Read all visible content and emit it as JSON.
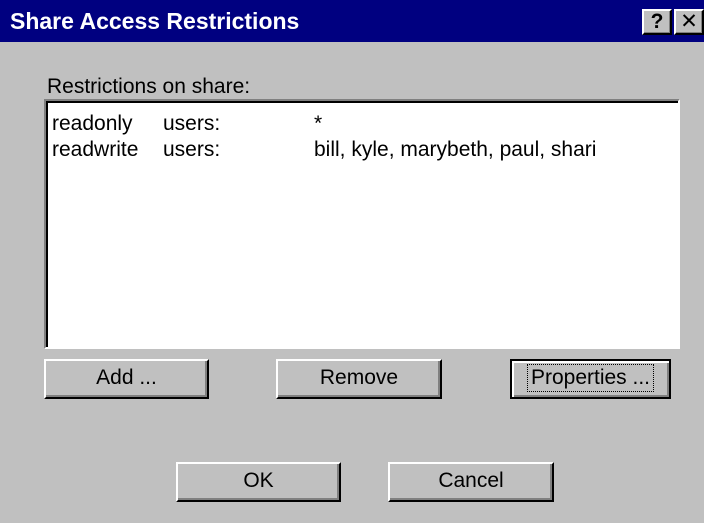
{
  "window": {
    "title": "Share Access Restrictions",
    "help_glyph": "?",
    "close_glyph": "✕"
  },
  "restrictions": {
    "label": "Restrictions on share:",
    "rows": [
      {
        "mode": "readonly",
        "type": "users:",
        "who": "*"
      },
      {
        "mode": "readwrite",
        "type": "users:",
        "who": "bill, kyle, marybeth, paul, shari"
      }
    ]
  },
  "buttons": {
    "add": "Add ...",
    "remove": "Remove",
    "properties": "Properties ...",
    "ok": "OK",
    "cancel": "Cancel"
  },
  "colors": {
    "titlebar": "#000080",
    "face": "#c0c0c0",
    "list_bg": "#ffffff"
  }
}
